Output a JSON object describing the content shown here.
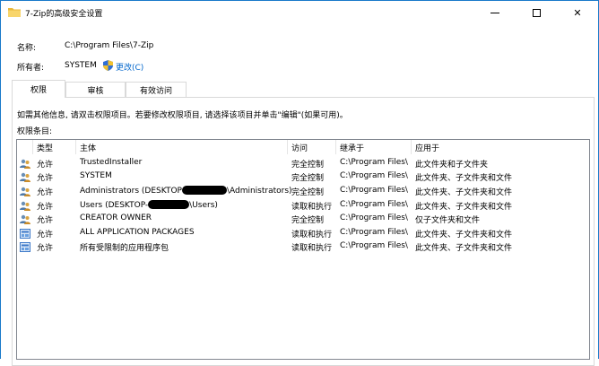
{
  "window": {
    "title": "7-Zip的高级安全设置"
  },
  "props": {
    "name_label": "名称:",
    "name_value": "C:\\Program Files\\7-Zip",
    "owner_label": "所有者:",
    "owner_value": "SYSTEM",
    "change_link": "更改(C)"
  },
  "tabs": [
    {
      "label": "权限",
      "active": true
    },
    {
      "label": "审核",
      "active": false
    },
    {
      "label": "有效访问",
      "active": false
    }
  ],
  "info_text": "如需其他信息, 请双击权限项目。若要修改权限项目, 请选择该项目并单击\"编辑\"(如果可用)。",
  "list_title": "权限条目:",
  "columns": [
    "类型",
    "主体",
    "访问",
    "继承于",
    "应用于"
  ],
  "rows": [
    {
      "icon": "users-icon",
      "type": "允许",
      "principal": "TrustedInstaller",
      "access": "完全控制",
      "inherited": "C:\\Program Files\\",
      "applies": "此文件夹和子文件夹"
    },
    {
      "icon": "users-icon",
      "type": "允许",
      "principal": "SYSTEM",
      "access": "完全控制",
      "inherited": "C:\\Program Files\\",
      "applies": "此文件夹、子文件夹和文件"
    },
    {
      "icon": "users-icon",
      "type": "允许",
      "principal_pre": "Administrators (DESKTOP",
      "principal_post": "\\Administrators)",
      "access": "完全控制",
      "inherited": "C:\\Program Files\\",
      "applies": "此文件夹、子文件夹和文件"
    },
    {
      "icon": "users-icon",
      "type": "允许",
      "principal_pre": "Users (DESKTOP-",
      "principal_post": "\\Users)",
      "access": "读取和执行",
      "inherited": "C:\\Program Files\\",
      "applies": "此文件夹、子文件夹和文件"
    },
    {
      "icon": "users-icon",
      "type": "允许",
      "principal": "CREATOR OWNER",
      "access": "完全控制",
      "inherited": "C:\\Program Files\\",
      "applies": "仅子文件夹和文件"
    },
    {
      "icon": "package-icon",
      "type": "允许",
      "principal": "ALL APPLICATION PACKAGES",
      "access": "读取和执行",
      "inherited": "C:\\Program Files\\",
      "applies": "此文件夹、子文件夹和文件"
    },
    {
      "icon": "package-icon",
      "type": "允许",
      "principal": "所有受限制的应用程序包",
      "access": "读取和执行",
      "inherited": "C:\\Program Files\\",
      "applies": "此文件夹、子文件夹和文件"
    }
  ]
}
